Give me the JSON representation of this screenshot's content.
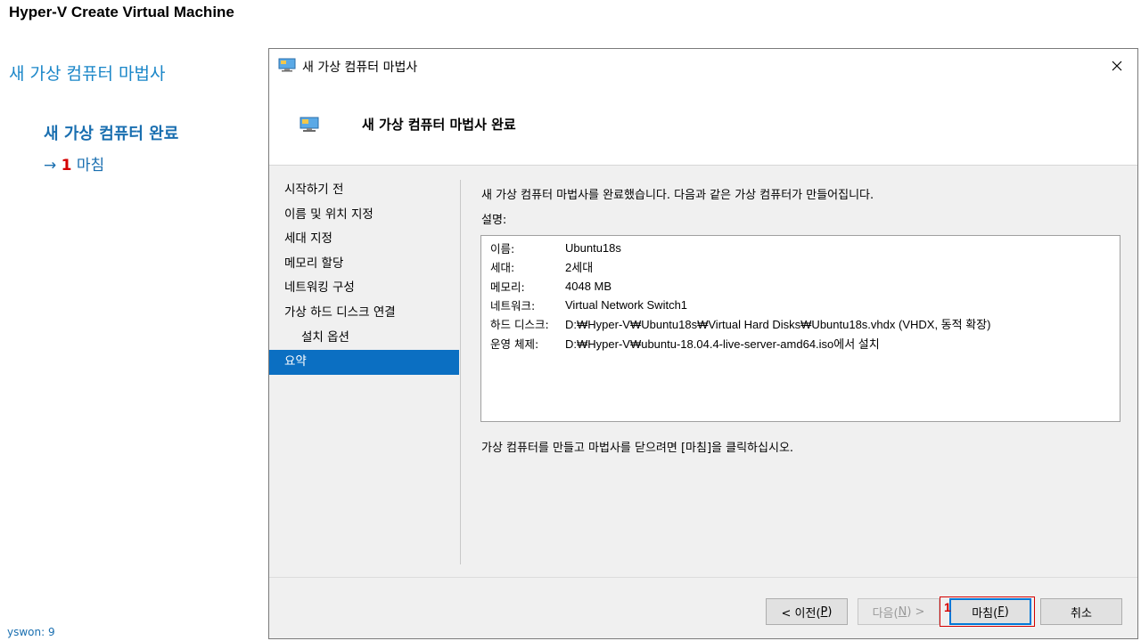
{
  "page": {
    "title": "Hyper-V Create Virtual Machine",
    "guide_title": "새 가상 컴퓨터 마법사",
    "guide_sub": "새 가상 컴퓨터 완료",
    "guide_arrow": "→",
    "guide_step_num": "1",
    "guide_step_label": "마침",
    "footer_note": "yswon:   9"
  },
  "dialog": {
    "title": "새 가상 컴퓨터 마법사",
    "header_title": "새 가상 컴퓨터 마법사 완료",
    "nav": [
      {
        "label": "시작하기 전",
        "selected": false,
        "indent": false
      },
      {
        "label": "이름 및 위치 지정",
        "selected": false,
        "indent": false
      },
      {
        "label": "세대 지정",
        "selected": false,
        "indent": false
      },
      {
        "label": "메모리 할당",
        "selected": false,
        "indent": false
      },
      {
        "label": "네트워킹 구성",
        "selected": false,
        "indent": false
      },
      {
        "label": "가상 하드 디스크 연결",
        "selected": false,
        "indent": false
      },
      {
        "label": "설치 옵션",
        "selected": false,
        "indent": true
      },
      {
        "label": "요약",
        "selected": true,
        "indent": false
      }
    ],
    "summary_intro": "새 가상 컴퓨터 마법사를 완료했습니다. 다음과 같은 가상 컴퓨터가 만들어집니다.",
    "summary_label": "설명:",
    "summary_rows": [
      {
        "key": "이름:",
        "value": "Ubuntu18s"
      },
      {
        "key": "세대:",
        "value": "2세대"
      },
      {
        "key": "메모리:",
        "value": "4048 MB"
      },
      {
        "key": "네트워크:",
        "value": "Virtual Network Switch1"
      },
      {
        "key": "하드 디스크:",
        "value": "D:₩Hyper-V₩Ubuntu18s₩Virtual Hard Disks₩Ubuntu18s.vhdx (VHDX, 동적 확장)"
      },
      {
        "key": "운영 체제:",
        "value": "D:₩Hyper-V₩ubuntu-18.04.4-live-server-amd64.iso에서 설치"
      }
    ],
    "finish_hint": "가상 컴퓨터를 만들고 마법사를 닫으려면 [마침]을 클릭하십시오.",
    "buttons": {
      "prev": {
        "label": "< 이전(",
        "mnemonic": "P",
        "suffix": ")"
      },
      "next": {
        "label": "다음(",
        "mnemonic": "N",
        "suffix": ") >"
      },
      "finish": {
        "label": "마침(",
        "mnemonic": "F",
        "suffix": ")"
      },
      "cancel": {
        "label": "취소"
      }
    },
    "finish_badge": "1"
  },
  "colors": {
    "accent_blue": "#0b6fc2",
    "annotation_red": "#d40000",
    "guide_blue": "#1a86c8"
  }
}
